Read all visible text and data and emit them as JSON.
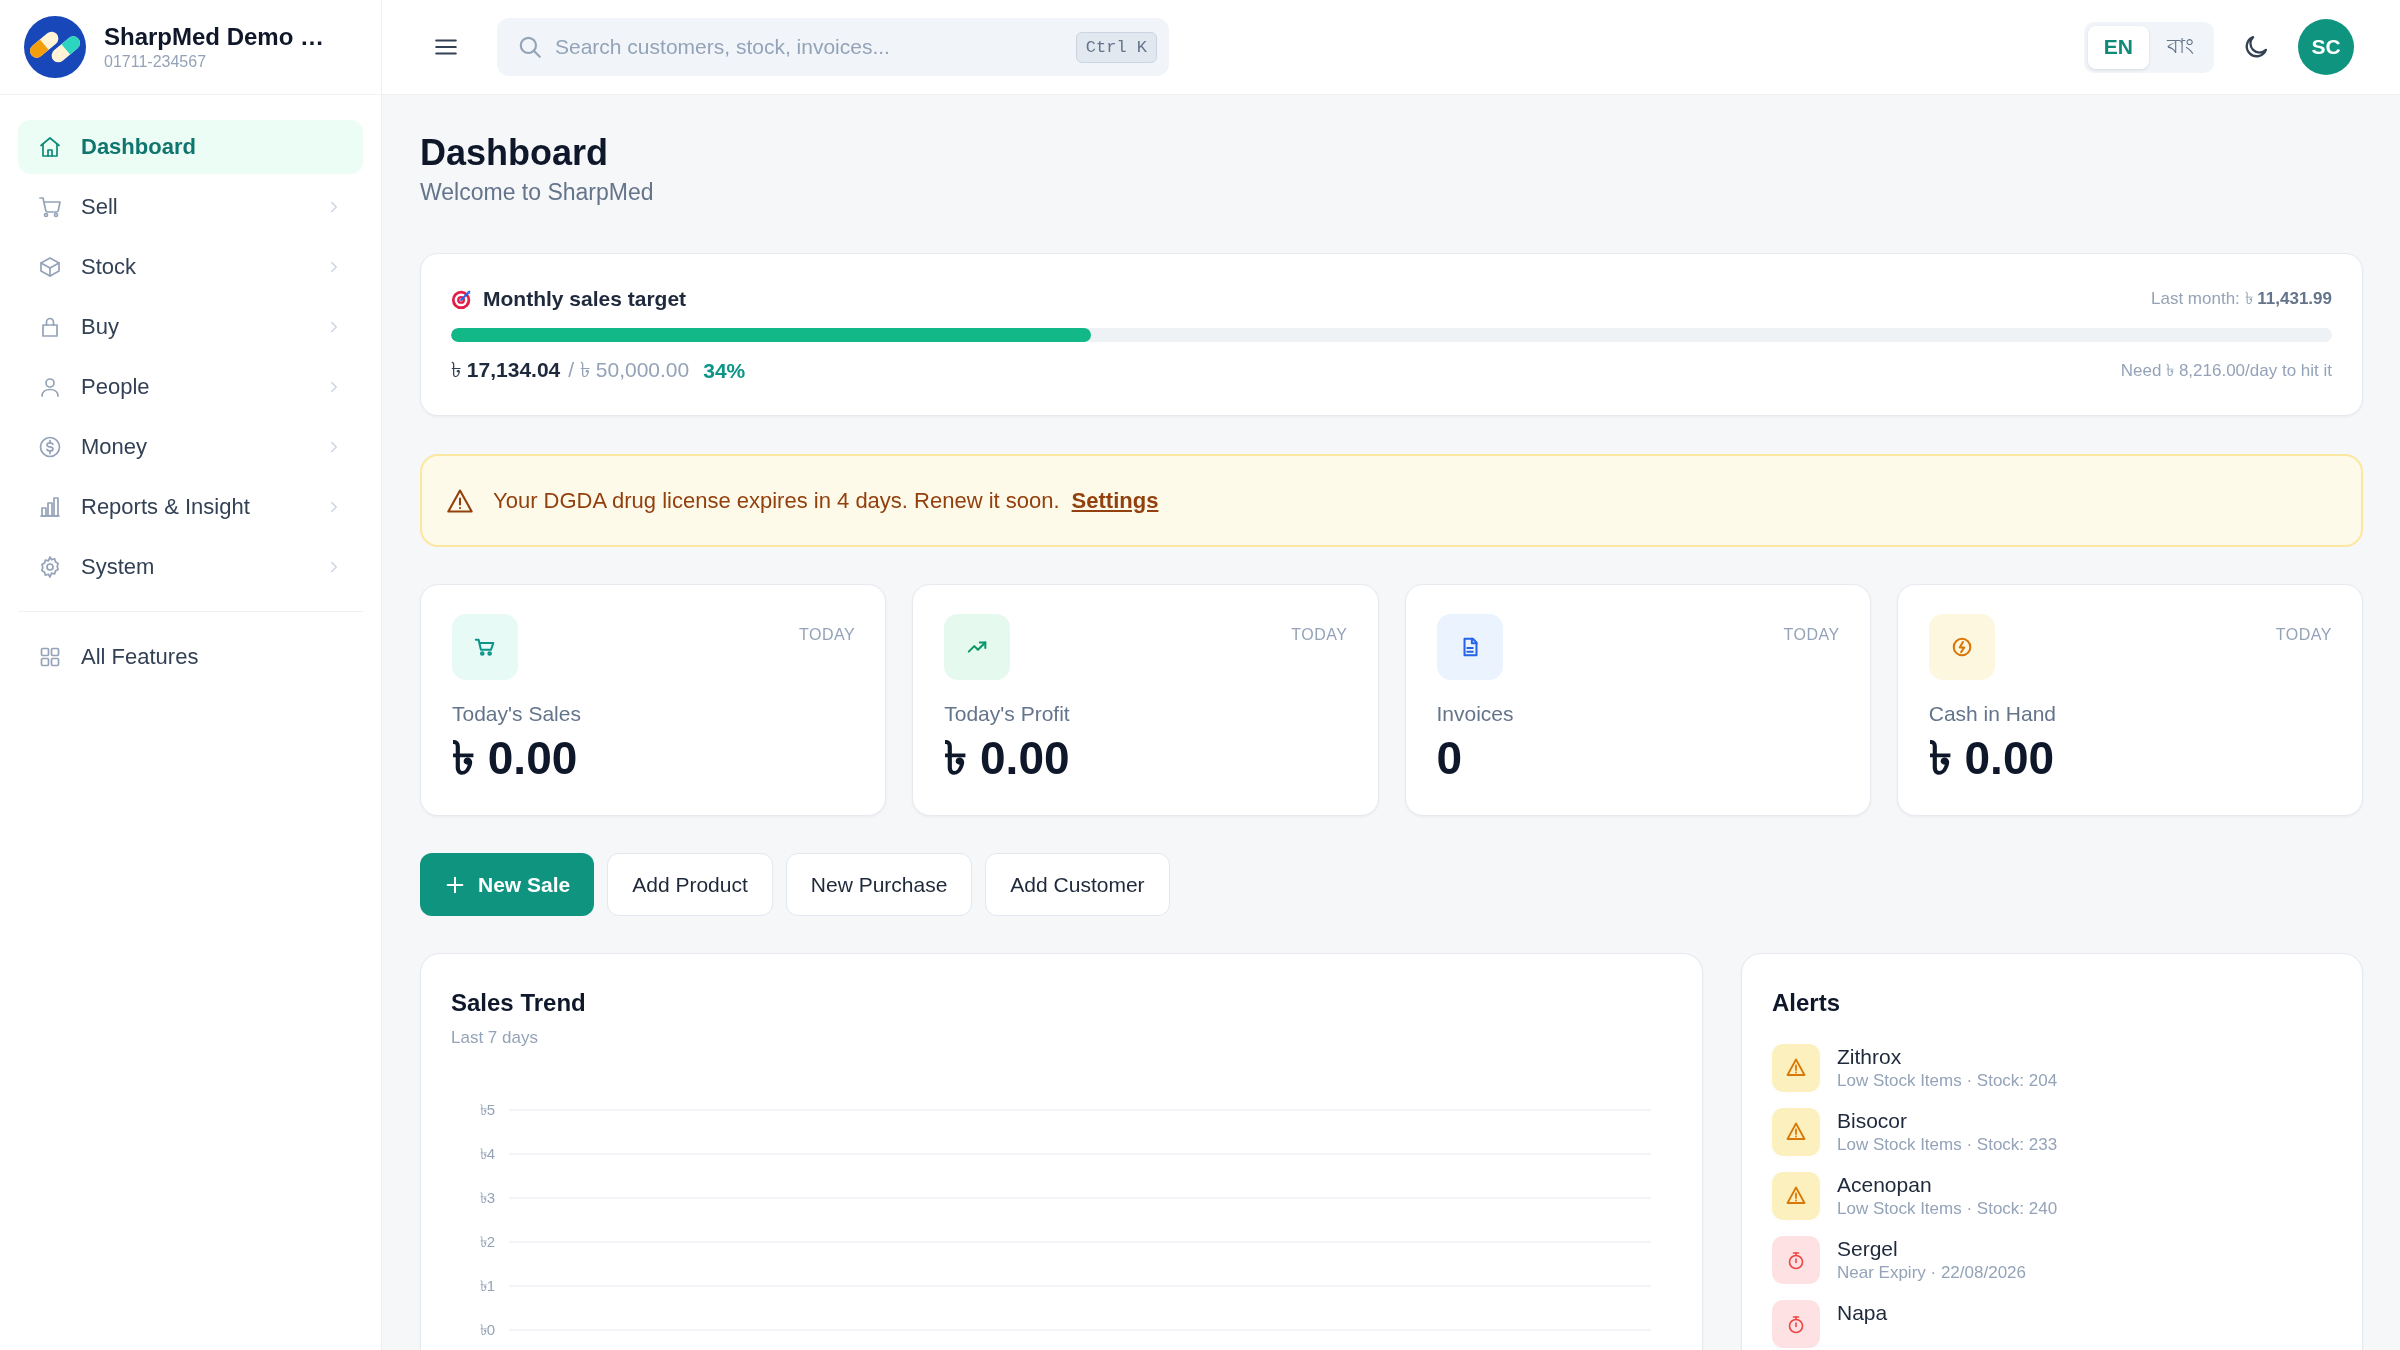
{
  "sidebar": {
    "brand": {
      "name": "SharpMed Demo …",
      "phone": "01711-234567"
    },
    "items": [
      {
        "label": "Dashboard",
        "selected": true,
        "has_submenu": false
      },
      {
        "label": "Sell",
        "selected": false,
        "has_submenu": true
      },
      {
        "label": "Stock",
        "selected": false,
        "has_submenu": true
      },
      {
        "label": "Buy",
        "selected": false,
        "has_submenu": true
      },
      {
        "label": "People",
        "selected": false,
        "has_submenu": true
      },
      {
        "label": "Money",
        "selected": false,
        "has_submenu": true
      },
      {
        "label": "Reports & Insight",
        "selected": false,
        "has_submenu": true
      },
      {
        "label": "System",
        "selected": false,
        "has_submenu": true
      }
    ],
    "footer_items": [
      {
        "label": "All Features",
        "selected": false
      }
    ]
  },
  "topbar": {
    "search": {
      "placeholder": "Search customers, stock, invoices...",
      "shortcut": "Ctrl K"
    },
    "languages": [
      {
        "label": "EN",
        "selected": true
      },
      {
        "label": "বাং",
        "selected": false
      }
    ],
    "avatar": "SC"
  },
  "page": {
    "title": "Dashboard",
    "subtitle": "Welcome to SharpMed"
  },
  "sales_target": {
    "title": "Monthly sales target",
    "last_month": "Last month: ৳ **11,431.99**",
    "level": 0.34,
    "achieved": "৳ **17,134.04**",
    "target": "/ ৳ 50,000.00",
    "percent": "34%",
    "need": "Need ৳ 8,216.00/day to hit it"
  },
  "notice": {
    "message": "Your DGDA drug license expires in 4 days. Renew it soon.",
    "link": "Settings"
  },
  "stats": [
    {
      "period": "TODAY",
      "label": "Today's Sales",
      "value": "৳ 0.00"
    },
    {
      "period": "TODAY",
      "label": "Today's Profit",
      "value": "৳ 0.00"
    },
    {
      "period": "TODAY",
      "label": "Invoices",
      "value": "0"
    },
    {
      "period": "TODAY",
      "label": "Cash in Hand",
      "value": "৳ 0.00"
    }
  ],
  "actions": [
    {
      "label": "New Sale",
      "kind": "primary"
    },
    {
      "label": "Add Product",
      "kind": "secondary"
    },
    {
      "label": "New Purchase",
      "kind": "secondary"
    },
    {
      "label": "Add Customer",
      "kind": "secondary"
    }
  ],
  "sales_trend": {
    "subtitle": "Last 7 days",
    "chart_data": {
      "type": "line",
      "title": "Sales Trend",
      "categories": [
        null,
        null,
        null,
        null,
        null,
        null,
        null
      ],
      "ylim": [
        0,
        5
      ],
      "yticks": [
        {
          "value": 5,
          "label": "৳5"
        },
        {
          "value": 4,
          "label": "৳4"
        },
        {
          "value": 3,
          "label": "৳3"
        },
        {
          "value": 2,
          "label": "৳2"
        },
        {
          "value": 1,
          "label": "৳1"
        },
        {
          "value": 0,
          "label": "৳0"
        }
      ],
      "grid": true
    }
  },
  "alerts": {
    "title": "Alerts",
    "items": [
      {
        "name": "Zithrox",
        "detail": "Low Stock Items · Stock: 204",
        "kind": "low_stock"
      },
      {
        "name": "Bisocor",
        "detail": "Low Stock Items · Stock: 233",
        "kind": "low_stock"
      },
      {
        "name": "Acenopan",
        "detail": "Low Stock Items · Stock: 240",
        "kind": "low_stock"
      },
      {
        "name": "Sergel",
        "detail": "Near Expiry · 22/08/2026",
        "kind": "expiry"
      },
      {
        "name": "Napa",
        "kind": "expiry"
      }
    ]
  }
}
